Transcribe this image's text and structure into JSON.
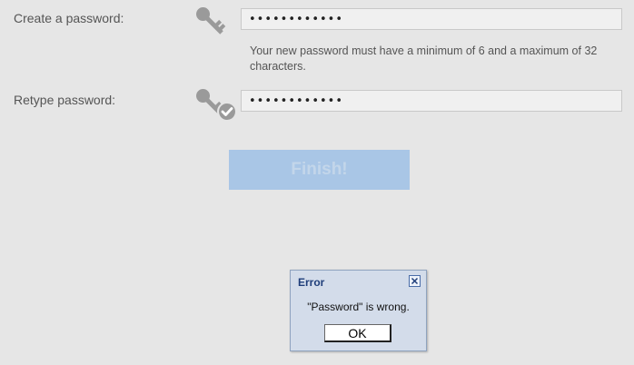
{
  "form": {
    "create_label": "Create a password:",
    "create_value": "••••••••••••",
    "hint": "Your new password must have a minimum of 6 and a maximum of 32 characters.",
    "retype_label": "Retype password:",
    "retype_value": "••••••••••••",
    "finish_label": "Finish!"
  },
  "dialog": {
    "title": "Error",
    "message": "\"Password\" is wrong.",
    "ok_label": "OK"
  },
  "icons": {
    "create": "key-icon",
    "retype": "key-check-icon",
    "close": "close-icon"
  },
  "colors": {
    "background": "#e6e6e6",
    "finish_button": "#a9c6e6",
    "dialog_background": "#d3dcea",
    "dialog_title": "#1f3e7a"
  }
}
